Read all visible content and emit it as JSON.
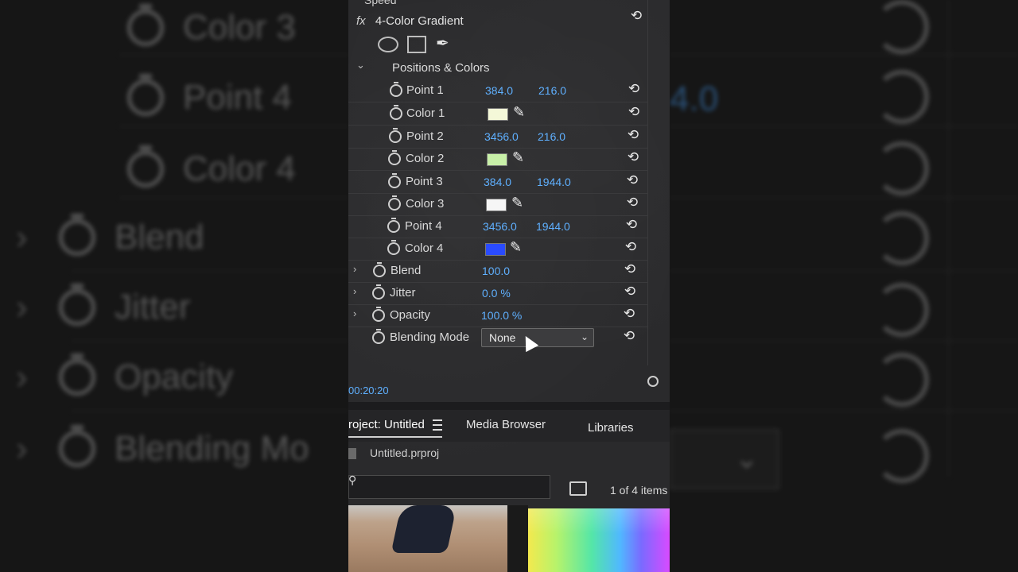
{
  "background": {
    "left_rows": [
      {
        "label": "Color 3",
        "stopwatch": true,
        "chevron": false
      },
      {
        "label": "Point 4",
        "stopwatch": true,
        "chevron": false
      },
      {
        "label": "Color 4",
        "stopwatch": true,
        "chevron": false
      },
      {
        "label": "Blend",
        "stopwatch": true,
        "chevron": true
      },
      {
        "label": "Jitter",
        "stopwatch": true,
        "chevron": true
      },
      {
        "label": "Opacity",
        "stopwatch": true,
        "chevron": true
      },
      {
        "label": "Blending Mo",
        "stopwatch": true,
        "chevron": true
      }
    ],
    "right_value": "4.0"
  },
  "effect_controls": {
    "speed_label": "Speed",
    "effect_name": "4-Color Gradient",
    "fx_label": "fx",
    "section_label": "Positions & Colors",
    "rows": [
      {
        "label": "Point 1",
        "v1": "384.0",
        "v2": "216.0"
      },
      {
        "label": "Color 1",
        "swatch": "#f4f8d8"
      },
      {
        "label": "Point 2",
        "v1": "3456.0",
        "v2": "216.0"
      },
      {
        "label": "Color 2",
        "swatch": "#c8f0a8"
      },
      {
        "label": "Point 3",
        "v1": "384.0",
        "v2": "1944.0"
      },
      {
        "label": "Color 3",
        "swatch": "#f6f6f6"
      },
      {
        "label": "Point 4",
        "v1": "3456.0",
        "v2": "1944.0"
      },
      {
        "label": "Color 4",
        "swatch": "#2a4bff"
      }
    ],
    "blend": {
      "label": "Blend",
      "value": "100.0"
    },
    "jitter": {
      "label": "Jitter",
      "value": "0.0 %"
    },
    "opacity": {
      "label": "Opacity",
      "value": "100.0 %"
    },
    "blending_mode": {
      "label": "Blending Mode",
      "selected": "None"
    },
    "timecode": "00:20:20"
  },
  "project_panel": {
    "tabs": [
      {
        "label": "roject: Untitled",
        "active": true
      },
      {
        "label": "Media Browser",
        "active": false
      },
      {
        "label": "Libraries",
        "active": false
      }
    ],
    "file_name": "Untitled.prproj",
    "items_count": "1 of 4 items"
  },
  "colors": {
    "accent_blue": "#5fb0ff",
    "panel_bg": "#2a2a2c"
  }
}
